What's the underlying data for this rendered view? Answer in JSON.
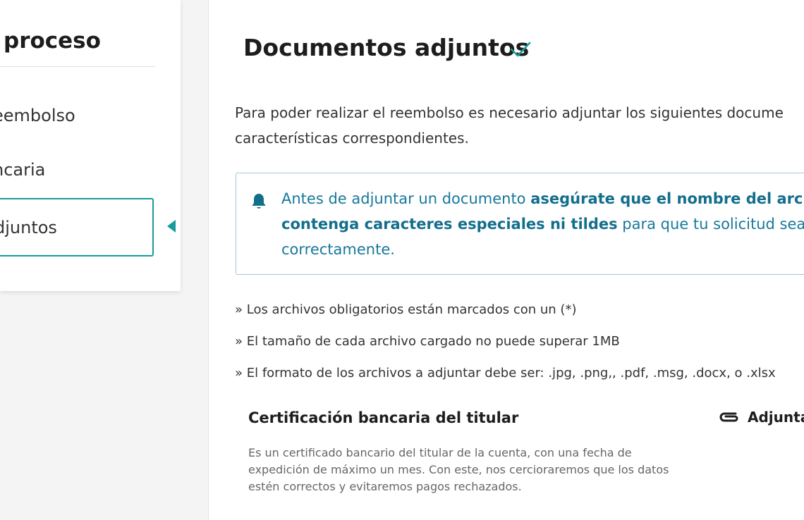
{
  "sidebar": {
    "title": "proceso",
    "steps": [
      {
        "label": "eembolso"
      },
      {
        "label": "ncaria"
      },
      {
        "label": "djuntos"
      }
    ]
  },
  "main": {
    "title": "Documentos adjuntos",
    "intro_lines": [
      "Para poder realizar el reembolso es necesario adjuntar los siguientes docume",
      "características correspondientes."
    ],
    "notice": {
      "line1_plain": "Antes de adjuntar un documento ",
      "line1_bold": "asegúrate que el nombre del archiv",
      "line2_bold": "contenga caracteres especiales ni tildes",
      "line2_plain": " para que tu solicitud sea rec",
      "line3_plain": "correctamente."
    },
    "rules": [
      "» Los archivos obligatorios están marcados con un (*)",
      "» El tamaño de cada archivo cargado no puede superar 1MB",
      "» El formato de los archivos a adjuntar debe ser: .jpg, .png,, .pdf, .msg, .docx, o .xlsx"
    ],
    "document": {
      "title": "Certificación bancaria del titular",
      "attach_label": "Adjunta",
      "description_lines": [
        "Es un certificado bancario del titular de la cuenta, con una fecha de",
        "expedición de máximo un mes. Con este, nos cercioraremos que los datos",
        "estén correctos y evitaremos pagos rechazados."
      ]
    }
  },
  "colors": {
    "accent": "#1a9a9a",
    "notice_text": "#17789a",
    "notice_border": "#9cc9d3"
  },
  "icons": {
    "title_check": "check-icon",
    "notice": "bell-icon",
    "attach": "paperclip-icon",
    "active_step": "triangle-left-icon"
  }
}
